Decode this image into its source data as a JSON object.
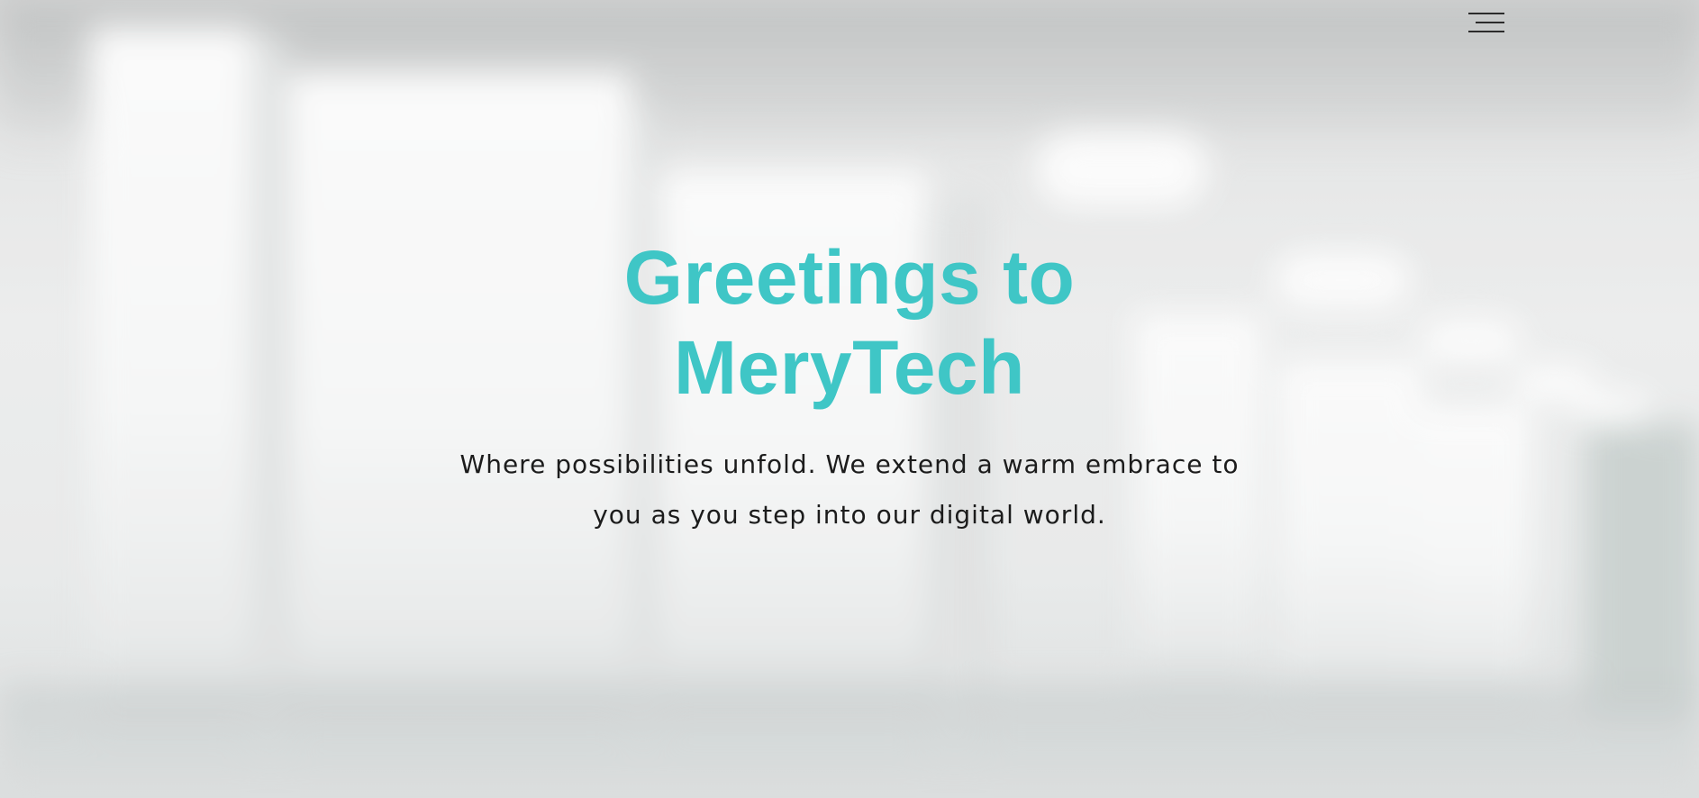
{
  "hero": {
    "title_line1": "Greetings to",
    "title_line2": "MeryTech",
    "subtitle": "Where possibilities unfold. We extend a warm embrace to you as you step into our digital world."
  },
  "nav": {
    "menu_icon": "hamburger-menu-icon"
  },
  "colors": {
    "accent": "#3fc6c6",
    "text": "#1c1c1c"
  }
}
